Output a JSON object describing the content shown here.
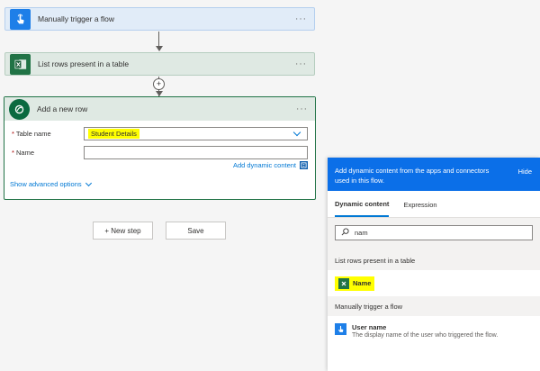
{
  "steps": {
    "trigger": {
      "title": "Manually trigger a flow",
      "menu": "···"
    },
    "list_rows": {
      "title": "List rows present in a table",
      "menu": "···"
    },
    "add_row": {
      "title": "Add a new row",
      "menu": "···",
      "fields": [
        {
          "required_mark": "*",
          "label": "Table name",
          "value": "Student Details"
        },
        {
          "required_mark": "*",
          "label": "Name",
          "value": ""
        }
      ],
      "add_dynamic_label": "Add dynamic content",
      "show_advanced_label": "Show advanced options"
    },
    "insert_symbol": "+"
  },
  "actions": {
    "new_step_label": "+ New step",
    "save_label": "Save"
  },
  "dynamic_panel": {
    "header_text": "Add dynamic content from the apps and connectors used in this flow.",
    "hide_label": "Hide",
    "tabs": [
      {
        "label": "Dynamic content",
        "active": true
      },
      {
        "label": "Expression",
        "active": false
      }
    ],
    "search": {
      "value": "nam"
    },
    "sections": [
      {
        "title": "List rows present in a table",
        "items": [
          {
            "label": "Name"
          }
        ]
      },
      {
        "title": "Manually trigger a flow",
        "items": [
          {
            "label": "User name",
            "description": "The display name of the user who triggered the flow."
          }
        ]
      }
    ]
  },
  "colors": {
    "accent": "#0078d4",
    "excel_green": "#217346",
    "highlight": "#ffff00",
    "panel_header": "#0b6fe8"
  }
}
